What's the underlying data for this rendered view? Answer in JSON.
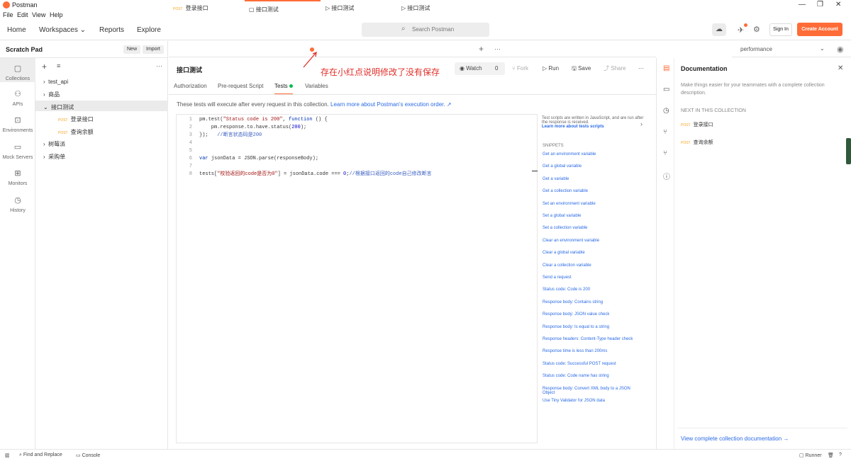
{
  "app": {
    "title": "Postman"
  },
  "menu": [
    "File",
    "Edit",
    "View",
    "Help"
  ],
  "header": {
    "nav": [
      "Home",
      "Workspaces",
      "Reports",
      "Explore"
    ],
    "search_placeholder": "Search Postman",
    "sign_in": "Sign In",
    "create_account": "Create Account"
  },
  "left": {
    "scratch_pad": "Scratch Pad",
    "new_btn": "New",
    "import_btn": "Import",
    "rail": [
      "Collections",
      "APIs",
      "Environments",
      "Mock Servers",
      "Monitors",
      "History"
    ],
    "tree": [
      {
        "label": "test_api"
      },
      {
        "label": "商品"
      },
      {
        "label": "接口测试"
      },
      {
        "method": "POST",
        "label": "登录接口"
      },
      {
        "method": "POST",
        "label": "查询余额"
      },
      {
        "label": "树莓派"
      },
      {
        "label": "采购单"
      }
    ]
  },
  "tabs": [
    {
      "method": "POST",
      "label": "登录接口"
    },
    {
      "label": "接口测试"
    },
    {
      "label": "接口测试"
    },
    {
      "label": "接口测试"
    }
  ],
  "environment": "performance",
  "annotation": "存在小红点说明修改了没有保存",
  "request": {
    "title": "接口测试",
    "watch": "Watch",
    "watch_count": "0",
    "fork": "Fork",
    "run": "Run",
    "save": "Save",
    "share": "Share",
    "subtabs": [
      "Authorization",
      "Pre-request Script",
      "Tests",
      "Variables"
    ],
    "info_text": "These tests will execute after every request in this collection.",
    "info_link": "Learn more about Postman's execution order. ↗"
  },
  "editor": {
    "lines": [
      "1",
      "2",
      "3",
      "4",
      "5",
      "6",
      "7",
      "8"
    ]
  },
  "snippets": {
    "intro": "Test scripts are written in JavaScript, and are run after the response is received.",
    "learn": "Learn more about tests scripts",
    "heading": "SNIPPETS",
    "items": [
      "Get an environment variable",
      "Get a global variable",
      "Get a variable",
      "Get a collection variable",
      "Set an environment variable",
      "Set a global variable",
      "Set a collection variable",
      "Clear an environment variable",
      "Clear a global variable",
      "Clear a collection variable",
      "Send a request",
      "Status code: Code is 200",
      "Response body: Contains string",
      "Response body: JSON value check",
      "Response body: Is equal to a string",
      "Response headers: Content-Type header check",
      "Response time is less than 200ms",
      "Status code: Successful POST request",
      "Status code: Code name has string",
      "Response body: Convert XML body to a JSON Object",
      "Use Tiny Validator for JSON data"
    ]
  },
  "docs": {
    "title": "Documentation",
    "desc": "Make things easier for your teammates with a complete collection description.",
    "next": "NEXT IN THIS COLLECTION",
    "items": [
      {
        "method": "POST",
        "label": "登录接口"
      },
      {
        "method": "POST",
        "label": "查询余额"
      }
    ],
    "link": "View complete collection documentation →"
  },
  "statusbar": {
    "find": "Find and Replace",
    "console": "Console",
    "runner": "Runner"
  }
}
